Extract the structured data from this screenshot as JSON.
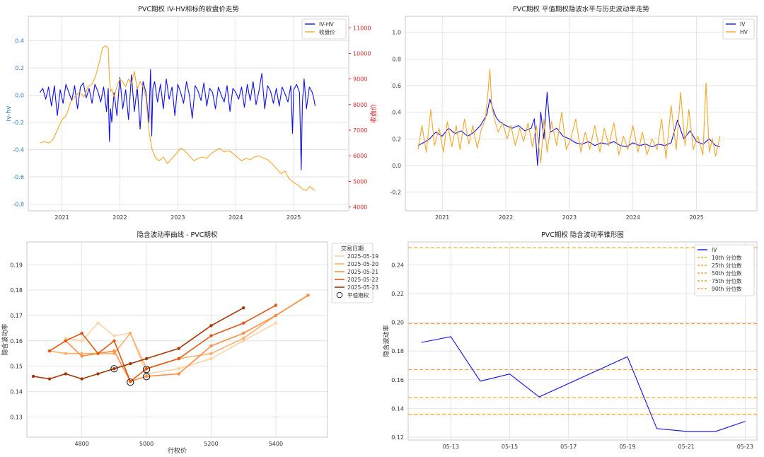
{
  "chart_data": [
    {
      "type": "line",
      "title": "PVC期权 IV-HV和标的收盘价走势",
      "ylabel": "iv-hv",
      "y2label": "收盘价",
      "x_ticks": [
        "2021",
        "2022",
        "2023",
        "2024",
        "2025"
      ],
      "y_ticks": [
        "0.4",
        "0.2",
        "0.0",
        "-0.2",
        "-0.4",
        "-0.6",
        "-0.8"
      ],
      "y2_ticks": [
        "11000",
        "10000",
        "9000",
        "8000",
        "7000",
        "6000",
        "5000",
        "4000"
      ],
      "xlim": [
        2020.42,
        2025.95
      ],
      "ylim": [
        -0.85,
        0.58
      ],
      "y2lim": [
        3850,
        11450
      ],
      "legend": [
        "IV-HV",
        "收盘价"
      ],
      "legend_position": "top-right",
      "grid": true,
      "series": [
        {
          "name": "IV-HV",
          "color": "#1010ee",
          "x": [
            2020.62,
            2020.67,
            2020.72,
            2020.77,
            2020.82,
            2020.87,
            2020.92,
            2020.97,
            2021.02,
            2021.07,
            2021.12,
            2021.17,
            2021.22,
            2021.27,
            2021.32,
            2021.37,
            2021.42,
            2021.47,
            2021.52,
            2021.57,
            2021.62,
            2021.67,
            2021.72,
            2021.77,
            2021.8,
            2021.82,
            2021.84,
            2021.86,
            2021.9,
            2021.95,
            2022.0,
            2022.05,
            2022.1,
            2022.15,
            2022.2,
            2022.25,
            2022.3,
            2022.35,
            2022.4,
            2022.45,
            2022.5,
            2022.53,
            2022.55,
            2022.57,
            2022.6,
            2022.65,
            2022.7,
            2022.75,
            2022.8,
            2022.85,
            2022.9,
            2022.95,
            2023.0,
            2023.05,
            2023.1,
            2023.15,
            2023.2,
            2023.25,
            2023.3,
            2023.35,
            2023.4,
            2023.45,
            2023.5,
            2023.55,
            2023.6,
            2023.65,
            2023.7,
            2023.75,
            2023.8,
            2023.85,
            2023.9,
            2023.95,
            2024.0,
            2024.05,
            2024.1,
            2024.15,
            2024.2,
            2024.25,
            2024.3,
            2024.35,
            2024.4,
            2024.45,
            2024.5,
            2024.55,
            2024.6,
            2024.65,
            2024.7,
            2024.75,
            2024.8,
            2024.85,
            2024.9,
            2024.95,
            2024.98,
            2025.0,
            2025.05,
            2025.1,
            2025.13,
            2025.15,
            2025.18,
            2025.22,
            2025.27,
            2025.32,
            2025.35,
            2025.37
          ],
          "y": [
            0.02,
            0.05,
            -0.03,
            0.06,
            -0.08,
            0.07,
            -0.15,
            0.04,
            -0.06,
            0.08,
            0.02,
            -0.04,
            0.07,
            -0.1,
            0.06,
            0.09,
            -0.02,
            0.05,
            -0.06,
            0.08,
            0.03,
            -0.05,
            0.06,
            -0.12,
            0.05,
            -0.34,
            -0.1,
            -0.2,
            0.02,
            -0.15,
            0.13,
            -0.1,
            0.04,
            -0.18,
            0.15,
            -0.12,
            0.06,
            -0.25,
            0.1,
            0.02,
            -0.2,
            0.19,
            -0.3,
            0.05,
            0.1,
            -0.05,
            0.08,
            -0.1,
            0.12,
            -0.03,
            0.06,
            -0.15,
            0.08,
            0.02,
            -0.06,
            0.1,
            0.0,
            -0.17,
            0.07,
            0.03,
            -0.04,
            0.09,
            -0.08,
            0.05,
            0.02,
            -0.1,
            0.06,
            0.0,
            -0.05,
            0.07,
            -0.12,
            0.05,
            0.02,
            -0.03,
            0.06,
            -0.09,
            0.08,
            -0.04,
            0.1,
            -0.07,
            0.03,
            0.16,
            -0.1,
            0.07,
            0.03,
            -0.06,
            0.05,
            -0.08,
            0.06,
            0.01,
            -0.05,
            0.07,
            -0.28,
            0.04,
            0.08,
            0.02,
            -0.55,
            -0.05,
            0.12,
            -0.1,
            0.06,
            0.02,
            -0.03,
            -0.08
          ]
        },
        {
          "name": "收盘价",
          "color": "#f5a623",
          "axis": "right",
          "x": [
            2020.62,
            2020.7,
            2020.78,
            2020.85,
            2020.92,
            2021.0,
            2021.08,
            2021.15,
            2021.22,
            2021.3,
            2021.38,
            2021.45,
            2021.52,
            2021.58,
            2021.65,
            2021.7,
            2021.75,
            2021.8,
            2021.82,
            2021.84,
            2021.86,
            2021.9,
            2021.95,
            2022.0,
            2022.05,
            2022.1,
            2022.15,
            2022.2,
            2022.25,
            2022.3,
            2022.35,
            2022.4,
            2022.45,
            2022.5,
            2022.55,
            2022.58,
            2022.62,
            2022.68,
            2022.75,
            2022.82,
            2022.9,
            2022.98,
            2023.05,
            2023.12,
            2023.2,
            2023.28,
            2023.35,
            2023.42,
            2023.5,
            2023.58,
            2023.65,
            2023.72,
            2023.8,
            2023.88,
            2023.95,
            2024.02,
            2024.1,
            2024.18,
            2024.25,
            2024.32,
            2024.4,
            2024.48,
            2024.55,
            2024.62,
            2024.7,
            2024.78,
            2024.85,
            2024.92,
            2025.0,
            2025.08,
            2025.15,
            2025.22,
            2025.28,
            2025.33,
            2025.37
          ],
          "y": [
            6500,
            6550,
            6500,
            6650,
            7000,
            7400,
            7600,
            8100,
            8300,
            8500,
            8300,
            8700,
            8800,
            9100,
            9700,
            10200,
            10300,
            10200,
            9000,
            8500,
            8600,
            8300,
            8700,
            9000,
            8900,
            8700,
            9000,
            8800,
            9300,
            8600,
            8900,
            8700,
            8300,
            7000,
            6300,
            6100,
            5900,
            5800,
            5950,
            5700,
            5900,
            6100,
            6300,
            6200,
            6000,
            5800,
            5900,
            5950,
            5900,
            6100,
            6200,
            6300,
            6150,
            6200,
            6100,
            5950,
            5800,
            5900,
            5850,
            5950,
            6000,
            5900,
            5850,
            5700,
            5500,
            5300,
            5400,
            5100,
            4950,
            4850,
            4700,
            4650,
            4800,
            4700,
            4650
          ]
        }
      ]
    },
    {
      "type": "line",
      "title": "PVC期权 平值期权隐波水平与历史波动率走势",
      "x_ticks": [
        "2021",
        "2022",
        "2023",
        "2024",
        "2025"
      ],
      "y_ticks": [
        "1.0",
        "0.8",
        "0.6",
        "0.4",
        "0.2",
        "0.0",
        "-0.2"
      ],
      "xlim": [
        2020.42,
        2025.95
      ],
      "ylim": [
        -0.34,
        1.12
      ],
      "legend": [
        "IV",
        "HV"
      ],
      "legend_position": "top-right",
      "grid": true,
      "series": [
        {
          "name": "IV",
          "color": "#1010ee",
          "x": [
            2020.62,
            2020.7,
            2020.8,
            2020.9,
            2021.0,
            2021.1,
            2021.2,
            2021.3,
            2021.4,
            2021.5,
            2021.6,
            2021.7,
            2021.75,
            2021.8,
            2021.85,
            2021.9,
            2022.0,
            2022.1,
            2022.2,
            2022.3,
            2022.4,
            2022.45,
            2022.5,
            2022.55,
            2022.6,
            2022.65,
            2022.7,
            2022.8,
            2022.9,
            2023.0,
            2023.1,
            2023.2,
            2023.3,
            2023.4,
            2023.5,
            2023.6,
            2023.7,
            2023.8,
            2023.9,
            2024.0,
            2024.1,
            2024.2,
            2024.3,
            2024.4,
            2024.5,
            2024.6,
            2024.7,
            2024.8,
            2024.9,
            2025.0,
            2025.1,
            2025.2,
            2025.3,
            2025.37
          ],
          "y": [
            0.15,
            0.17,
            0.2,
            0.25,
            0.22,
            0.28,
            0.24,
            0.26,
            0.22,
            0.25,
            0.3,
            0.38,
            0.5,
            0.42,
            0.36,
            0.33,
            0.3,
            0.28,
            0.3,
            0.26,
            0.28,
            0.35,
            0.0,
            0.4,
            0.2,
            0.55,
            0.25,
            0.28,
            0.22,
            0.2,
            0.17,
            0.16,
            0.18,
            0.15,
            0.17,
            0.16,
            0.18,
            0.15,
            0.14,
            0.17,
            0.15,
            0.16,
            0.14,
            0.16,
            0.15,
            0.17,
            0.34,
            0.2,
            0.26,
            0.18,
            0.16,
            0.2,
            0.15,
            0.14
          ]
        },
        {
          "name": "HV",
          "color": "#f5a623",
          "x": [
            2020.62,
            2020.68,
            2020.75,
            2020.82,
            2020.88,
            2020.95,
            2021.02,
            2021.08,
            2021.15,
            2021.22,
            2021.28,
            2021.35,
            2021.42,
            2021.48,
            2021.55,
            2021.62,
            2021.68,
            2021.72,
            2021.75,
            2021.78,
            2021.82,
            2021.88,
            2021.95,
            2022.02,
            2022.08,
            2022.15,
            2022.22,
            2022.28,
            2022.35,
            2022.42,
            2022.48,
            2022.55,
            2022.6,
            2022.65,
            2022.72,
            2022.8,
            2022.88,
            2022.95,
            2023.02,
            2023.1,
            2023.18,
            2023.25,
            2023.32,
            2023.4,
            2023.48,
            2023.55,
            2023.62,
            2023.7,
            2023.78,
            2023.85,
            2023.92,
            2024.0,
            2024.08,
            2024.15,
            2024.22,
            2024.3,
            2024.38,
            2024.45,
            2024.52,
            2024.6,
            2024.68,
            2024.75,
            2024.82,
            2024.88,
            2024.95,
            2025.02,
            2025.1,
            2025.15,
            2025.2,
            2025.25,
            2025.3,
            2025.37
          ],
          "y": [
            0.12,
            0.3,
            0.1,
            0.42,
            0.15,
            0.28,
            0.1,
            0.33,
            0.14,
            0.3,
            0.12,
            0.35,
            0.16,
            0.3,
            0.13,
            0.28,
            0.35,
            0.55,
            0.72,
            0.45,
            0.35,
            0.25,
            0.32,
            0.2,
            0.3,
            0.15,
            0.28,
            0.18,
            0.32,
            0.14,
            0.3,
            0.02,
            0.35,
            0.1,
            0.33,
            0.15,
            0.4,
            0.12,
            0.2,
            0.35,
            0.1,
            0.25,
            0.12,
            0.3,
            0.1,
            0.28,
            0.15,
            0.32,
            0.08,
            0.22,
            0.12,
            0.3,
            0.1,
            0.25,
            0.08,
            0.2,
            0.12,
            0.35,
            0.05,
            0.45,
            0.12,
            0.55,
            0.15,
            0.42,
            0.12,
            0.22,
            0.08,
            0.62,
            0.1,
            0.2,
            0.07,
            0.22
          ]
        }
      ]
    },
    {
      "type": "line",
      "title": "隐含波动率曲线 - PVC期权",
      "xlabel": "行权价",
      "ylabel": "隐含波动率",
      "x_ticks": [
        "4800",
        "5000",
        "5200",
        "5400"
      ],
      "y_ticks": [
        "0.19",
        "0.18",
        "0.17",
        "0.16",
        "0.15",
        "0.14",
        "0.13"
      ],
      "xlim": [
        4630,
        5560
      ],
      "ylim": [
        0.122,
        0.199
      ],
      "legend_title": "交易日期",
      "legend": [
        "2025-05-19",
        "2025-05-20",
        "2025-05-21",
        "2025-05-22",
        "2025-05-23",
        "平值期权"
      ],
      "legend_position": "outside-right",
      "grid": true,
      "series": [
        {
          "name": "2025-05-19",
          "color": "#fdd3a6",
          "x": [
            4750,
            4800,
            4850,
            4900,
            4950,
            5000,
            5100,
            5200,
            5300,
            5400
          ],
          "y": [
            0.161,
            0.16,
            0.167,
            0.162,
            0.163,
            0.147,
            0.149,
            0.153,
            0.16,
            0.167
          ]
        },
        {
          "name": "2025-05-20",
          "color": "#fdae6b",
          "x": [
            4700,
            4750,
            4800,
            4850,
            4900,
            4950,
            5000,
            5100,
            5200,
            5300,
            5400,
            5500
          ],
          "y": [
            0.156,
            0.155,
            0.155,
            0.155,
            0.155,
            0.163,
            0.149,
            0.153,
            0.155,
            0.161,
            0.17,
            0.178
          ]
        },
        {
          "name": "2025-05-21",
          "color": "#fd8d3c",
          "x": [
            4750,
            4800,
            4850,
            4900,
            4950,
            5000,
            5100,
            5200,
            5300,
            5400,
            5500
          ],
          "y": [
            0.16,
            0.154,
            0.155,
            0.156,
            0.144,
            0.146,
            0.147,
            0.158,
            0.163,
            0.17,
            0.178
          ]
        },
        {
          "name": "2025-05-22",
          "color": "#e6550d",
          "x": [
            4700,
            4750,
            4800,
            4850,
            4900,
            4950,
            5000,
            5100,
            5200,
            5300,
            5400
          ],
          "y": [
            0.156,
            0.16,
            0.163,
            0.155,
            0.16,
            0.144,
            0.149,
            0.153,
            0.162,
            0.167,
            0.174
          ]
        },
        {
          "name": "2025-05-23",
          "color": "#a63603",
          "x": [
            4650,
            4700,
            4750,
            4800,
            4850,
            4900,
            4950,
            5000,
            5100,
            5200,
            5300
          ],
          "y": [
            0.146,
            0.145,
            0.147,
            0.145,
            0.147,
            0.149,
            0.151,
            0.153,
            0.157,
            0.166,
            0.173
          ]
        }
      ],
      "atm_points": [
        {
          "x": 4900,
          "y": 0.149
        },
        {
          "x": 4950,
          "y": 0.1437
        },
        {
          "x": 5000,
          "y": 0.1487
        },
        {
          "x": 5000,
          "y": 0.1459
        }
      ]
    },
    {
      "type": "line",
      "title": "PVC期权 隐含波动率锥形图",
      "ylabel": "隐含波动率",
      "x_ticks": [
        "05-13",
        "05-15",
        "05-17",
        "05-19",
        "05-21",
        "05-23"
      ],
      "y_ticks": [
        "0.24",
        "0.22",
        "0.20",
        "0.18",
        "0.16",
        "0.14",
        "0.12"
      ],
      "xlim": [
        11.55,
        23.4
      ],
      "ylim": [
        0.118,
        0.256
      ],
      "legend": [
        "IV",
        "10th 分位数",
        "25th 分位数",
        "50th 分位数",
        "75th 分位数",
        "90th 分位数"
      ],
      "legend_position": "top-right",
      "grid": true,
      "series": [
        {
          "name": "IV",
          "color": "#1010ee",
          "x": [
            12,
            13,
            14,
            15,
            16,
            19,
            20,
            21,
            22,
            23
          ],
          "y": [
            0.186,
            0.19,
            0.159,
            0.164,
            0.148,
            0.176,
            0.126,
            0.124,
            0.124,
            0.131
          ]
        }
      ],
      "percentiles": [
        {
          "name": "10th 分位数",
          "value": 0.136,
          "color": "#f5a623"
        },
        {
          "name": "25th 分位数",
          "value": 0.1475,
          "color": "#f5a623"
        },
        {
          "name": "50th 分位数",
          "value": 0.167,
          "color": "#f5a623"
        },
        {
          "name": "75th 分位数",
          "value": 0.199,
          "color": "#f5a623"
        },
        {
          "name": "90th 分位数",
          "value": 0.252,
          "color": "#f5a623"
        }
      ]
    }
  ]
}
